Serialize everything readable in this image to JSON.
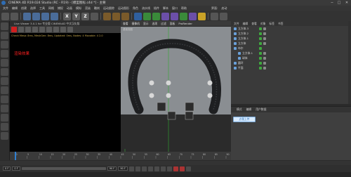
{
  "window": {
    "title": "CINEMA 4D R19.024 Studio (RC - R19) - [模型图标.c4d *] - 主要",
    "min": "−",
    "max": "□",
    "close": "✕"
  },
  "menu": [
    "文件",
    "编辑",
    "创建",
    "选择",
    "工具",
    "网格",
    "捕捉",
    "动画",
    "模拟",
    "渲染",
    "雕刻",
    "运动跟踪",
    "运动图形",
    "角色",
    "流水线",
    "插件",
    "脚本",
    "窗口",
    "帮助",
    "界面:",
    "启动"
  ],
  "toolbar": {
    "labels": [
      "X",
      "Y",
      "Z"
    ],
    "colors": {
      "red": "#d23b2e",
      "blue": "#2f5f9e",
      "green": "#3a8a3a",
      "yellow": "#c9a227",
      "purple": "#6b4fa8"
    }
  },
  "render_panel": {
    "header": "Live Viewer 3.0.1 for 专业版 CINEMA4D 中文汉化版",
    "info": "Check Mesa: 8ms, MeshGen: 8ms, Updated: 0ms, Nodes: 4 Movable: 4 2.0",
    "note": "渲染效果",
    "stats": [
      "Rendering",
      "Ms/sec",
      "Time",
      "Spp/maxspp",
      "Tri: 0/0",
      "Mesh: 0",
      "Hair: 0",
      "GPU: 0"
    ]
  },
  "viewport": {
    "tabs": [
      "查看",
      "摄像机",
      "显示",
      "选项",
      "过滤",
      "面板",
      "ProRender"
    ],
    "label": "透视视图",
    "grid": "网格间距：1000 cm"
  },
  "objects": {
    "menu": [
      "文件",
      "编辑",
      "查看",
      "对象",
      "标签",
      "书签"
    ],
    "rows": [
      "立方体.3",
      "立方体.2",
      "立方体.1",
      "立方体",
      "布尔",
      "立方体.1",
      "球体",
      "圆环",
      "平面"
    ]
  },
  "attributes": {
    "tabs": [
      "模式",
      "编辑",
      "用户数据"
    ],
    "upload_label": "点我上传"
  },
  "timeline": {
    "ticks": [
      "0",
      "5",
      "10",
      "15",
      "20",
      "25",
      "30",
      "35",
      "40",
      "45",
      "50",
      "55",
      "60",
      "65",
      "70",
      "75",
      "80",
      "85",
      "90"
    ],
    "labels": [
      "0 F",
      "0 F",
      "90 F",
      "90 F"
    ]
  }
}
